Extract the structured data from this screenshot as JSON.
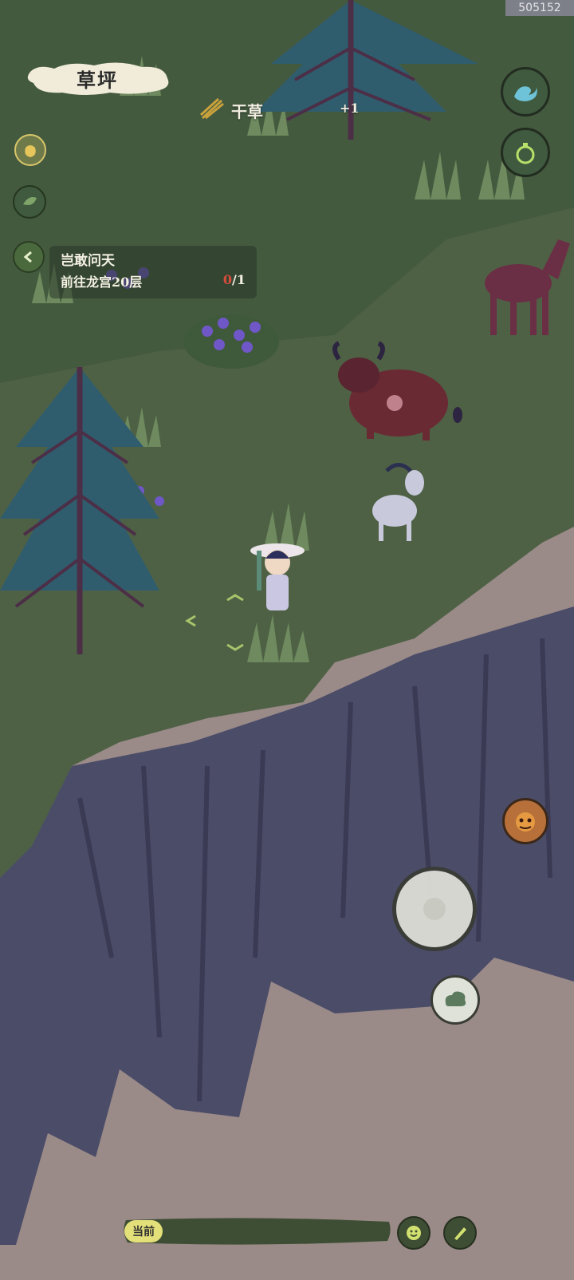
{
  "screen_id": "505152",
  "location": {
    "name": "草坪"
  },
  "item_pickup": {
    "name": "干草",
    "count": "+1"
  },
  "quest": {
    "title": "岂敢问天",
    "description": "前往龙宫20层",
    "progress_current": "0",
    "progress_total": "/1"
  },
  "chat": {
    "channel": "当前"
  },
  "icons": {
    "quest_back": "chevron-left-icon",
    "bag": "pouch-icon",
    "leaf": "leaf-icon",
    "wave": "wave-icon",
    "gourd": "gourd-icon",
    "monster": "monster-face-icon",
    "joystick": "joystick-icon",
    "cloud_skill": "cloud-swirl-icon",
    "emoji": "smile-icon",
    "write": "brush-icon"
  }
}
